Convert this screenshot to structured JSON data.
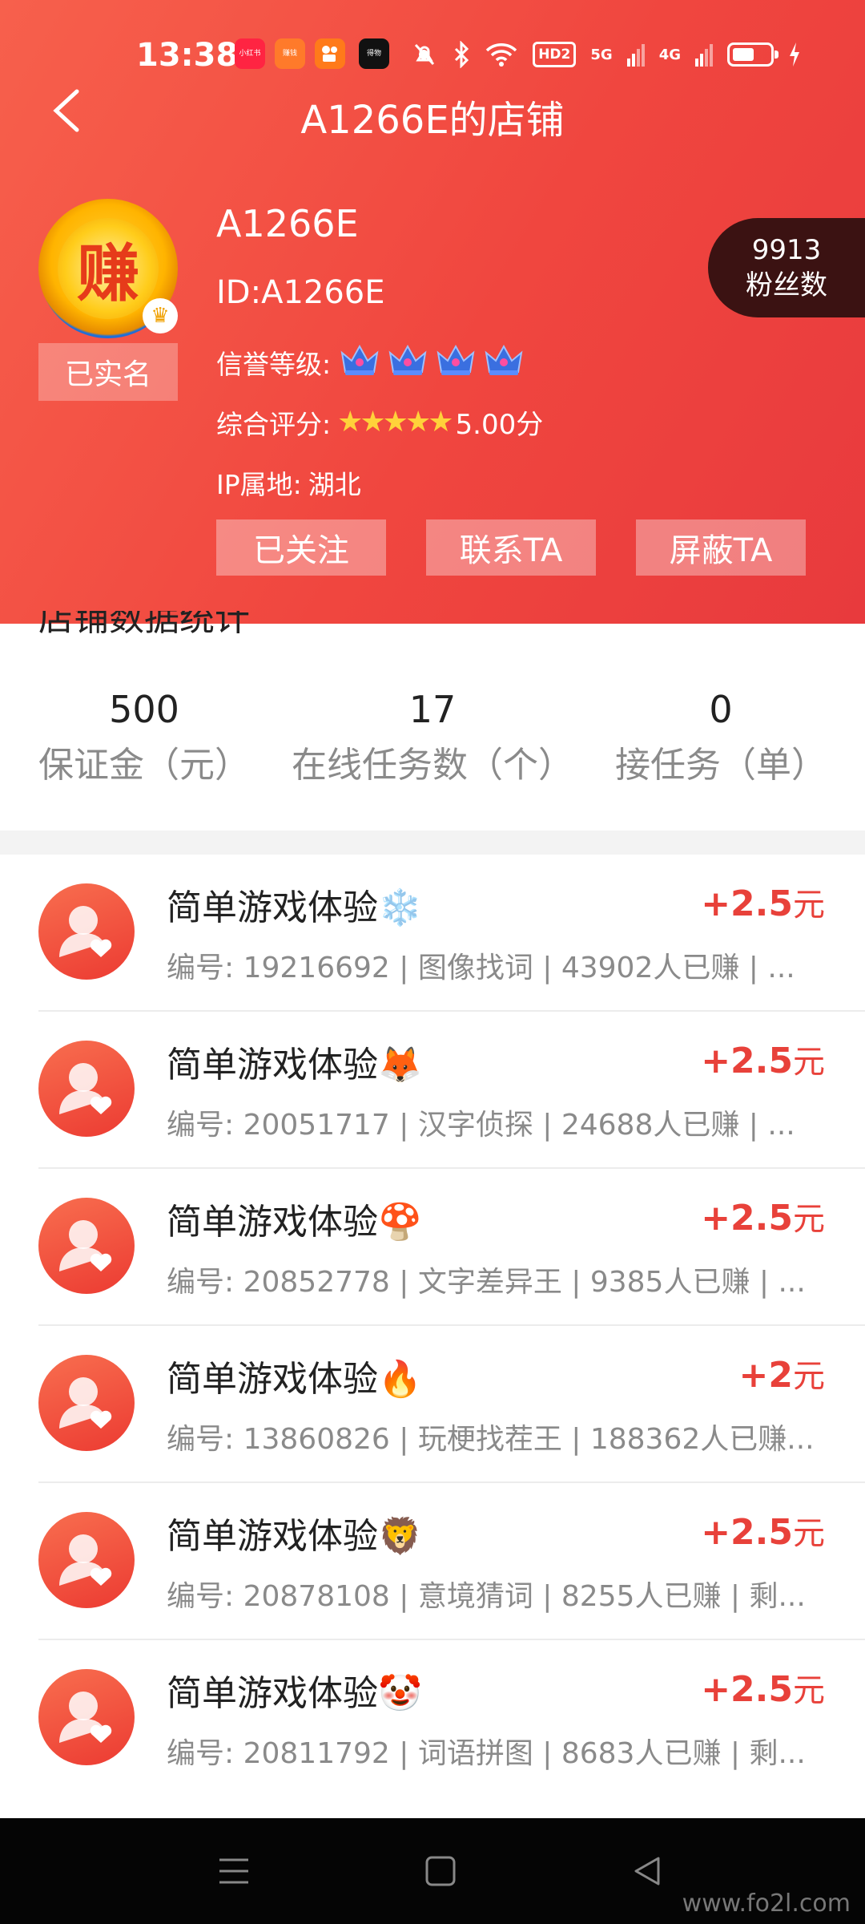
{
  "status_bar": {
    "time": "13:38",
    "apps": [
      {
        "name": "xiaohongshu-icon",
        "label": "小红书",
        "color": "#ff2442"
      },
      {
        "name": "zhuanqian-icon",
        "label": "赚钱",
        "color": "#ff6a2a"
      },
      {
        "name": "kuaishou-icon",
        "label": "",
        "color": "#ff7a1a"
      },
      {
        "name": "douyin-icon",
        "label": "得物",
        "color": "#111111"
      }
    ],
    "hd": "HD2",
    "net1": "5G",
    "net2": "4G",
    "battery_level": 0.6
  },
  "header": {
    "title": "A1266E的店铺",
    "avatar_char": "赚",
    "verified": "已实名",
    "username": "A1266E",
    "user_id": "ID:A1266E",
    "credit_label": "信誉等级:",
    "credit_level": 4,
    "rating_label": "综合评分:",
    "rating_stars": 5,
    "rating_score": "5.00分",
    "ip_label": "IP属地:",
    "ip_value": "湖北",
    "fans_count": "9913",
    "fans_label": "粉丝数",
    "buttons": {
      "follow": "已关注",
      "contact": "联系TA",
      "block": "屏蔽TA"
    }
  },
  "stats": {
    "title": "店铺数据统计",
    "items": [
      {
        "value": "500",
        "label": "保证金（元）"
      },
      {
        "value": "17",
        "label": "在线任务数（个）"
      },
      {
        "value": "0",
        "label": "接任务（单）"
      }
    ]
  },
  "tasks": [
    {
      "title": "简单游戏体验❄️",
      "price": "+2.5",
      "unit": "元",
      "desc": "编号:  19216692 | 图像找词 | 43902人已赚 | ..."
    },
    {
      "title": "简单游戏体验🦊",
      "price": "+2.5",
      "unit": "元",
      "desc": "编号:  20051717 | 汉字侦探 | 24688人已赚 | ..."
    },
    {
      "title": "简单游戏体验🍄",
      "price": "+2.5",
      "unit": "元",
      "desc": "编号:  20852778 | 文字差异王 | 9385人已赚 | ..."
    },
    {
      "title": "简单游戏体验🔥",
      "price": "+2",
      "unit": "元",
      "desc": "编号:  13860826 | 玩梗找茬王 | 188362人已赚..."
    },
    {
      "title": "简单游戏体验🦁",
      "price": "+2.5",
      "unit": "元",
      "desc": "编号:  20878108 | 意境猜词 | 8255人已赚 | 剩..."
    },
    {
      "title": "简单游戏体验🤡",
      "price": "+2.5",
      "unit": "元",
      "desc": "编号:  20811792 | 词语拼图 | 8683人已赚 | 剩..."
    }
  ],
  "watermark": "www.fo2l.com"
}
